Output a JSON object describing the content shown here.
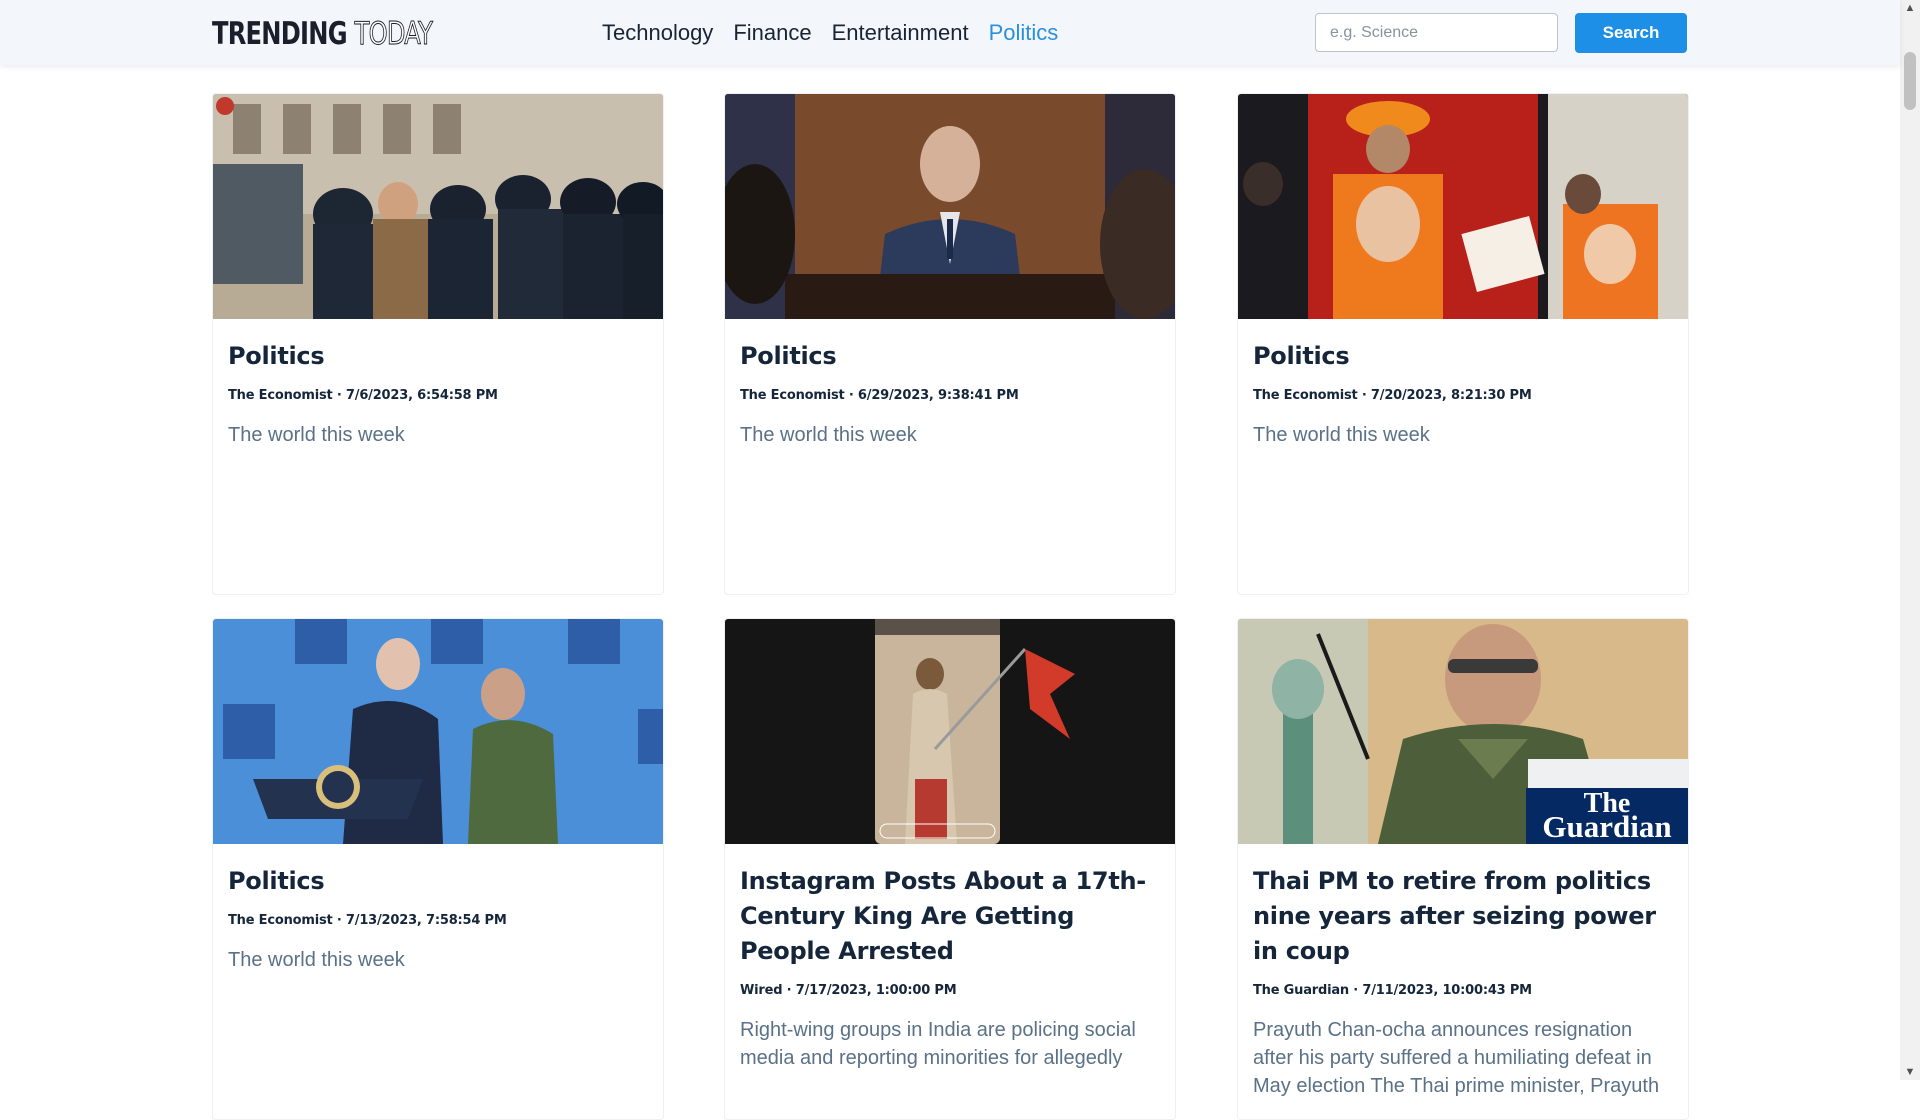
{
  "header": {
    "logo_part1": "TRENDING",
    "logo_part2": "TODAY",
    "nav": [
      {
        "label": "Technology"
      },
      {
        "label": "Finance"
      },
      {
        "label": "Entertainment"
      },
      {
        "label": "Politics",
        "active": true
      }
    ],
    "search_placeholder": "e.g. Science",
    "search_button": "Search"
  },
  "cards": [
    {
      "title": "Politics",
      "source": "The Economist",
      "date": "7/6/2023, 6:54:58 PM",
      "description": "The world this week"
    },
    {
      "title": "Politics",
      "source": "The Economist",
      "date": "6/29/2023, 9:38:41 PM",
      "description": "The world this week"
    },
    {
      "title": "Politics",
      "source": "The Economist",
      "date": "7/20/2023, 8:21:30 PM",
      "description": "The world this week"
    },
    {
      "title": "Politics",
      "source": "The Economist",
      "date": "7/13/2023, 7:58:54 PM",
      "description": "The world this week"
    },
    {
      "title": "Instagram Posts About a 17th-Century King Are Getting People Arrested",
      "source": "Wired",
      "date": "7/17/2023, 1:00:00 PM",
      "description": "Right-wing groups in India are policing social media and reporting minorities for allegedly"
    },
    {
      "title": "Thai PM to retire from politics nine years after seizing power in coup",
      "source": "The Guardian",
      "date": "7/11/2023, 10:00:43 PM",
      "description": "Prayuth Chan-ocha announces resignation after his party suffered a humiliating defeat in May election The Thai prime minister, Prayuth"
    }
  ],
  "thumb_badges": {
    "guardian_line1": "The",
    "guardian_line2": "Guardian"
  },
  "colors": {
    "accent": "#1d8fe6",
    "active_nav": "#2a8fdc",
    "header_bg": "#f3f7fb"
  },
  "icons": {
    "scroll_up": "▲",
    "scroll_down": "▼"
  }
}
